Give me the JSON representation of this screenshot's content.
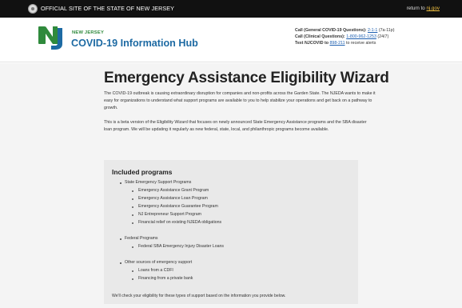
{
  "topbar": {
    "official_label": "OFFICIAL SITE OF THE STATE OF NEW JERSEY",
    "return_prefix": "return to",
    "return_link": "nj.gov"
  },
  "header": {
    "state_label": "NEW JERSEY",
    "hub_title": "COVID-19 Information Hub",
    "contact": {
      "general_label": "Call (General COVID-19 Questions):",
      "general_number": "2-1-1",
      "general_hours": "(7a-11p)",
      "clinical_label": "Call (Clinical Questions):",
      "clinical_number": "1-800-962-1253",
      "clinical_hours": "(24/7)",
      "text_label": "Text NJCOVID to",
      "text_number": "898-211",
      "text_suffix": "to receive alerts"
    }
  },
  "main": {
    "title": "Emergency Assistance Eligibility Wizard",
    "paragraph1": "The COVID-19 outbreak is causing extraordinary disruption for companies and non-profits across the Garden State. The NJEDA wants to make it easy for organizations to understand what support programs are available to you to help stabilize your operations and get back on a pathway to growth.",
    "paragraph2": "This is a beta version of the Eligibility Wizard that focuses on newly announced State Emergency Assistance programs and the SBA disaster loan program. We will be updating it regularly as new federal, state, local, and philanthropic programs become available."
  },
  "programs": {
    "heading": "Included programs",
    "groups": [
      {
        "label": "State Emergency Support Programs",
        "items": [
          "Emergency Assistance Grant Program",
          "Emergency Assistance Loan Program",
          "Emergency Assistance Guarantee Program",
          "NJ Entrepreneur Support Program",
          "Financial relief on existing NJEDA obligations"
        ]
      },
      {
        "label": "Federal Programs",
        "items": [
          "Federal SBA Emergency Injury Disaster Loans"
        ]
      },
      {
        "label": "Other sources of emergency support",
        "items": [
          "Loans from a CDFI",
          "Financing from a private bank"
        ]
      }
    ],
    "note": "We'll check your eligibility for these types of support based on the information you provide below."
  },
  "colors": {
    "topbar": "#111111",
    "brand_green": "#2f8a3c",
    "brand_blue": "#1d6aa3",
    "content_bg": "#f4f4f4",
    "programs_bg": "#e9e9e9"
  },
  "icons": {
    "seal": "nj-state-seal-icon",
    "logo": "nj-logo-icon"
  }
}
